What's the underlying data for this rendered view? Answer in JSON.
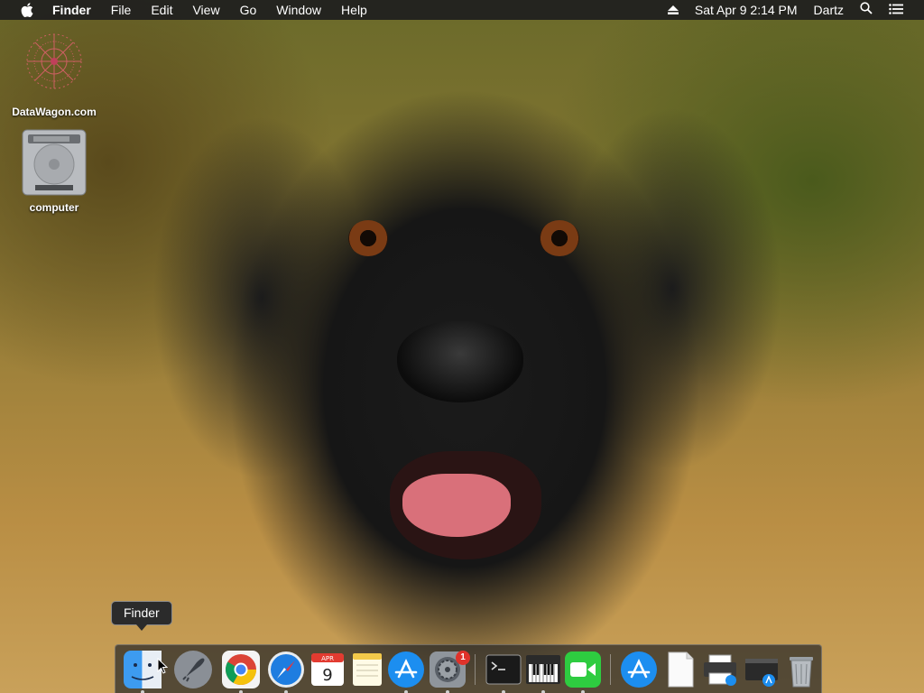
{
  "menubar": {
    "apple_icon": "apple-icon",
    "app_name": "Finder",
    "menus": [
      "File",
      "Edit",
      "View",
      "Go",
      "Window",
      "Help"
    ],
    "eject_icon": "eject-icon",
    "datetime": "Sat Apr 9  2:14 PM",
    "user": "Dartz",
    "search_icon": "spotlight-search-icon",
    "notifications_icon": "notification-center-icon"
  },
  "desktop_icons": [
    {
      "label": "DataWagon.com",
      "icon": "datawagon-logo-icon"
    },
    {
      "label": "computer",
      "icon": "hard-drive-icon"
    }
  ],
  "tooltip": {
    "text": "Finder"
  },
  "calendar": {
    "month": "APR",
    "day": "9"
  },
  "dock": {
    "items": [
      {
        "name": "Finder",
        "icon": "finder-icon",
        "running": true
      },
      {
        "name": "Launchpad",
        "icon": "launchpad-icon",
        "running": false
      },
      {
        "name": "Google Chrome",
        "icon": "chrome-icon",
        "running": true
      },
      {
        "name": "Safari",
        "icon": "safari-icon",
        "running": true
      },
      {
        "name": "Calendar",
        "icon": "calendar-icon",
        "running": false
      },
      {
        "name": "Notes",
        "icon": "notes-icon",
        "running": false
      },
      {
        "name": "App Store",
        "icon": "app-store-icon",
        "running": true
      },
      {
        "name": "System Preferences",
        "icon": "system-preferences-icon",
        "running": true,
        "badge": "1"
      },
      {
        "name": "Terminal",
        "icon": "terminal-icon",
        "running": true
      },
      {
        "name": "Piano",
        "icon": "piano-keyboard-icon",
        "running": true
      },
      {
        "name": "FaceTime",
        "icon": "facetime-icon",
        "running": true
      },
      {
        "name": "Applications",
        "icon": "applications-folder-icon",
        "running": false
      },
      {
        "name": "Document",
        "icon": "document-icon",
        "running": false
      },
      {
        "name": "Printer",
        "icon": "printer-icon",
        "running": false
      },
      {
        "name": "Installer",
        "icon": "installer-icon",
        "running": false
      },
      {
        "name": "Trash",
        "icon": "trash-icon",
        "running": false
      }
    ]
  },
  "colors": {
    "menubar_bg": "#1e1e1e",
    "dock_bg": "#282828",
    "badge_red": "#e0322a",
    "safari_blue": "#1e7de0",
    "facetime_green": "#2ecc40"
  }
}
